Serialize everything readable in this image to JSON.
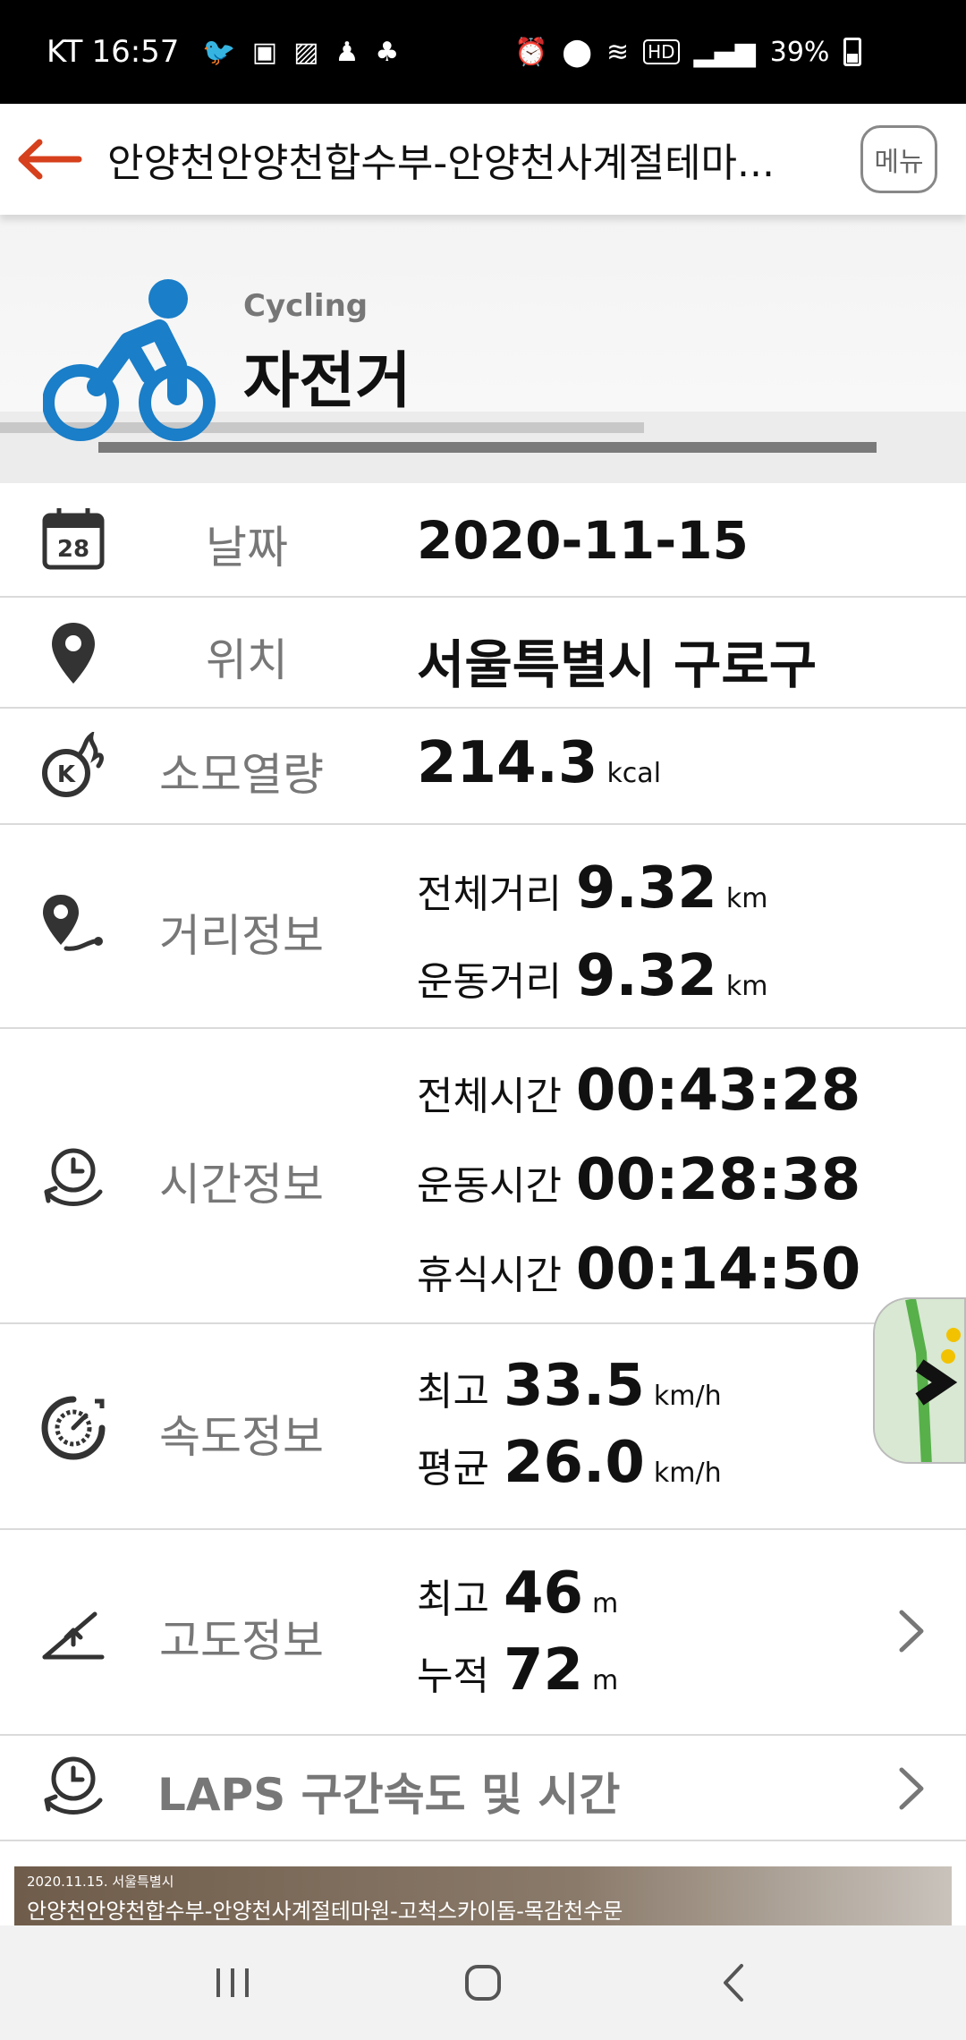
{
  "status": {
    "carrier": "KT",
    "time": "16:57",
    "battery": "39%",
    "icons": [
      "twitter-icon",
      "app-icon",
      "gallery-icon",
      "notification-icon",
      "app-icon",
      "alarm-icon",
      "location-icon",
      "wifi-icon",
      "hd-icon",
      "signal-icon",
      "battery-icon"
    ]
  },
  "header": {
    "title": "안양천안양천합수부-안양천사계절테마...",
    "menu_label": "메뉴"
  },
  "hero": {
    "subtitle": "Cycling",
    "title": "자전거"
  },
  "rows": {
    "date": {
      "label": "날짜",
      "value": "2020-11-15"
    },
    "location": {
      "label": "위치",
      "value": "서울특별시 구로구"
    },
    "calories": {
      "label": "소모열량",
      "value": "214.3",
      "unit": "kcal"
    },
    "distance": {
      "label": "거리정보",
      "total_label": "전체거리",
      "total_value": "9.32",
      "total_unit": "km",
      "moving_label": "운동거리",
      "moving_value": "9.32",
      "moving_unit": "km"
    },
    "time": {
      "label": "시간정보",
      "total_label": "전체시간",
      "total_value": "00:43:28",
      "moving_label": "운동시간",
      "moving_value": "00:28:38",
      "rest_label": "휴식시간",
      "rest_value": "00:14:50"
    },
    "speed": {
      "label": "속도정보",
      "max_label": "최고",
      "max_value": "33.5",
      "max_unit": "km/h",
      "avg_label": "평균",
      "avg_value": "26.0",
      "avg_unit": "km/h"
    },
    "altitude": {
      "label": "고도정보",
      "max_label": "최고",
      "max_value": "46",
      "max_unit": "m",
      "cum_label": "누적",
      "cum_value": "72",
      "cum_unit": "m"
    },
    "laps": {
      "label": "LAPS 구간속도 및 시간"
    }
  },
  "banner": {
    "date": "2020.11.15. 서울특별시",
    "title": "안양천안양천합수부-안양천사계절테마원-고척스카이돔-목감천수문"
  },
  "colors": {
    "accent": "#d6401c",
    "cycling_blue": "#1a7ec8",
    "label_gray": "#777777"
  }
}
